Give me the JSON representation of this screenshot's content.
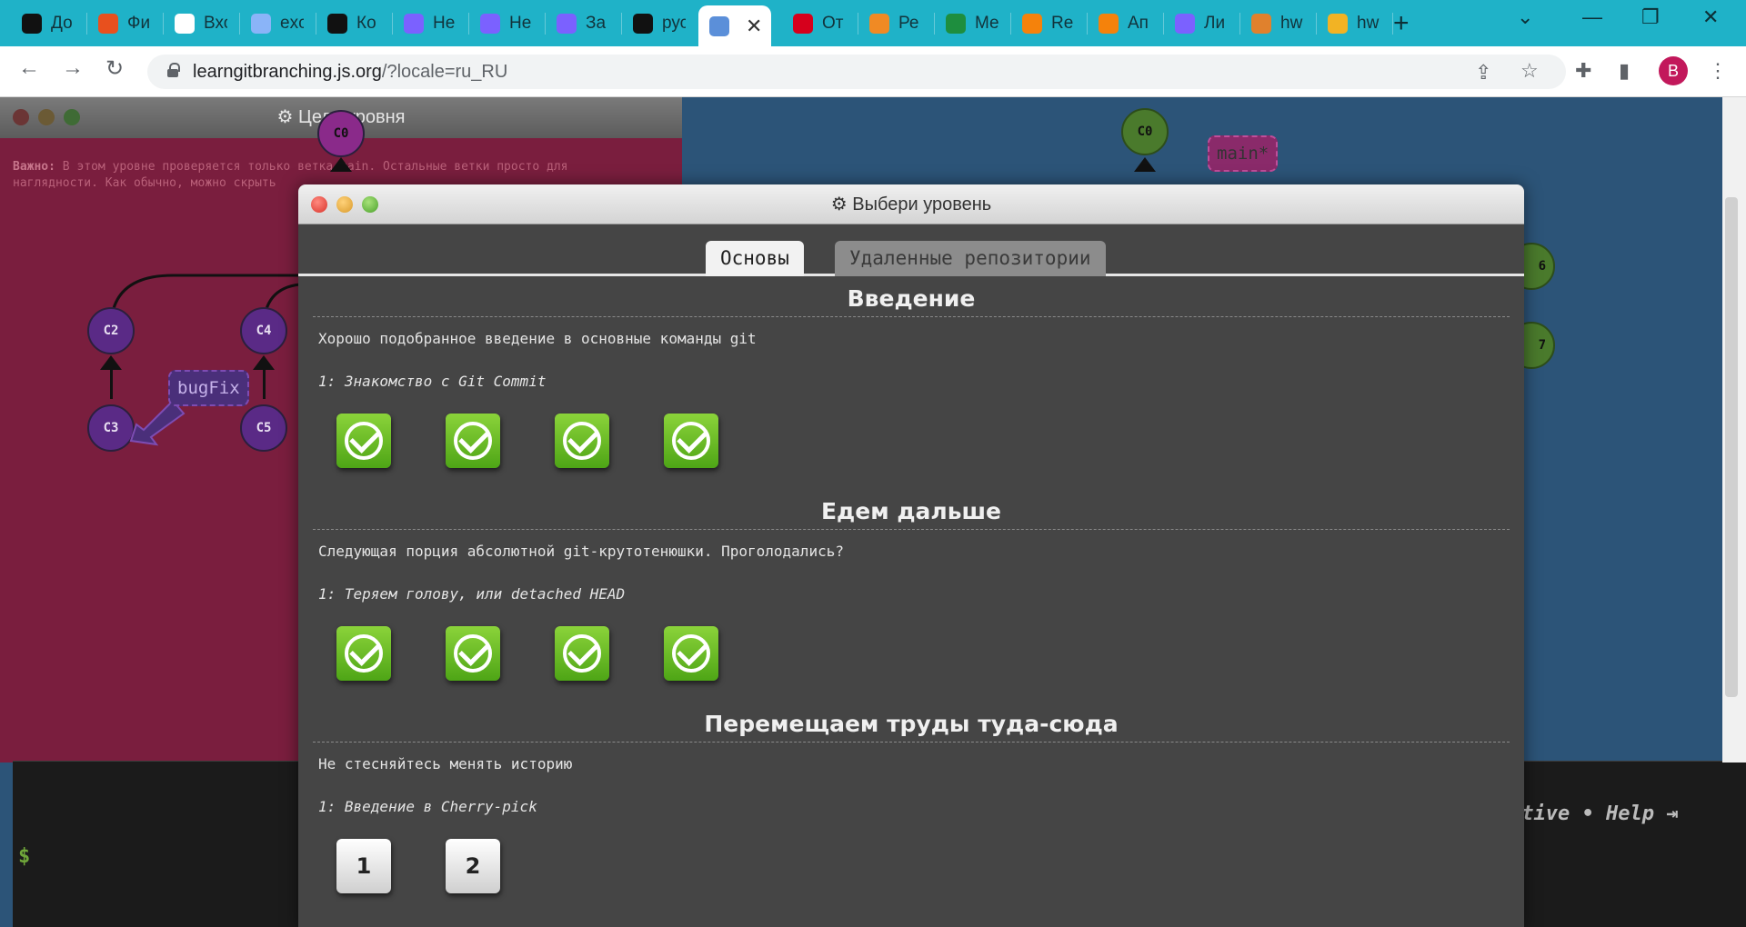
{
  "browser": {
    "tabs": [
      {
        "title": "До",
        "icon": "circle-p-icon",
        "color": "#111111"
      },
      {
        "title": "Фи",
        "icon": "k-icon",
        "color": "#e8501e"
      },
      {
        "title": "Вхо",
        "icon": "gmail-icon",
        "color": "#ffffff"
      },
      {
        "title": "exc",
        "icon": "drive-icon",
        "color": "#8ab4f8"
      },
      {
        "title": "Ко",
        "icon": "github-icon",
        "color": "#111111"
      },
      {
        "title": "Не",
        "icon": "flower-icon",
        "color": "#7b61ff"
      },
      {
        "title": "Не",
        "icon": "flower-icon",
        "color": "#7b61ff"
      },
      {
        "title": "За",
        "icon": "flower-icon",
        "color": "#7b61ff"
      },
      {
        "title": "рус",
        "icon": "github-icon",
        "color": "#111111"
      },
      {
        "title": "",
        "icon": "gitbranch-icon",
        "color": "#5b8fd9"
      },
      {
        "title": "От",
        "icon": "hh-icon",
        "color": "#d6001c"
      },
      {
        "title": "Ре",
        "icon": "diamond-icon",
        "color": "#f08a24"
      },
      {
        "title": "Ме",
        "icon": "plus-icon",
        "color": "#1e8e3e"
      },
      {
        "title": "Re",
        "icon": "box-icon",
        "color": "#f5820b"
      },
      {
        "title": "Ап",
        "icon": "box-icon",
        "color": "#f5820b"
      },
      {
        "title": "Ли",
        "icon": "flower-icon",
        "color": "#7b61ff"
      },
      {
        "title": "hw",
        "icon": "spinner-icon",
        "color": "#e0812d"
      },
      {
        "title": "hw",
        "icon": "note-icon",
        "color": "#f2b324"
      }
    ],
    "close_glyph": "✕",
    "new_tab_glyph": "+",
    "url_host": "learngitbranching.js.org",
    "url_rest": "/?locale=ru_RU",
    "profile_initial": "B"
  },
  "goal": {
    "title": "Цель уровня",
    "note_bold": "Важно:",
    "note_line1": " В этом уровне проверяется только ветка main. Остальные ветки просто для",
    "note_line2": "наглядности. Как обычно, можно скрыть",
    "node_c0": "C0",
    "node_c2": "C2",
    "node_c3": "C3",
    "node_c4": "C4",
    "node_c5": "C5",
    "branch_bugfix": "bugFix"
  },
  "main_view": {
    "node_c0": "C0",
    "node_c6_partial": "6",
    "node_c7_partial": "7",
    "branch_main_partial": "main*"
  },
  "terminal": {
    "prompt": "$",
    "help_text": "ctive • Help"
  },
  "modal": {
    "title": "Выбери уровень",
    "tabs": [
      "Основы",
      "Удаленные репозитории"
    ],
    "sections": [
      {
        "title": "Введение",
        "description": "Хорошо подобранное введение в основные команды git",
        "level_label": "1: Знакомство с Git Commit",
        "levels": [
          {
            "label": "",
            "completed": true
          },
          {
            "label": "",
            "completed": true
          },
          {
            "label": "",
            "completed": true
          },
          {
            "label": "",
            "completed": true
          }
        ]
      },
      {
        "title": "Едем дальше",
        "description": "Следующая порция абсолютной git-крутотенюшки. Проголодались?",
        "level_label": "1: Теряем голову, или detached HEAD",
        "levels": [
          {
            "label": "",
            "completed": true
          },
          {
            "label": "",
            "completed": true
          },
          {
            "label": "",
            "completed": true
          },
          {
            "label": "",
            "completed": true
          }
        ]
      },
      {
        "title": "Перемещаем труды туда-сюда",
        "description": "Не стесняйтесь менять историю",
        "level_label": "1: Введение в Cherry-pick",
        "levels": [
          {
            "label": "1",
            "completed": false
          },
          {
            "label": "2",
            "completed": false
          }
        ]
      }
    ]
  }
}
